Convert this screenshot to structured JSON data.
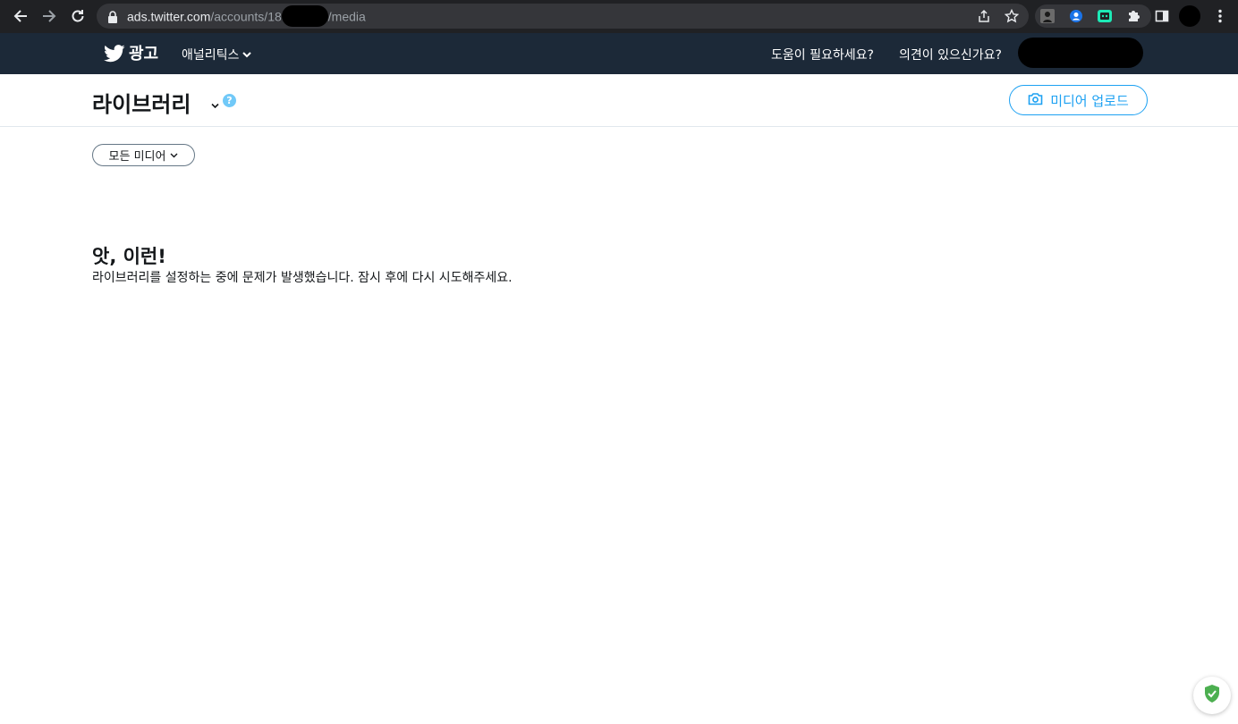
{
  "browser": {
    "url_host": "ads.twitter.com",
    "url_path_prefix": "/accounts/18",
    "url_path_suffix": "/media",
    "icons": [
      "back-icon",
      "forward-icon",
      "reload-icon",
      "lock-icon",
      "share-icon",
      "bookmark-star-icon",
      "extension-icon",
      "side-panel-icon",
      "profile-avatar",
      "menu-icon"
    ]
  },
  "ads_header": {
    "brand": "광고",
    "analytics_label": "애널리틱스",
    "help_label": "도움이 필요하세요?",
    "feedback_label": "의견이 있으신가요?"
  },
  "page": {
    "title": "라이브러리",
    "help_glyph": "?",
    "upload_label": "미디어 업로드",
    "filter_label": "모든 미디어"
  },
  "error": {
    "title": "앗, 이런!",
    "message": "라이브러리를 설정하는 중에 문제가 발생했습니다. 잠시 후에 다시 시도해주세요."
  },
  "colors": {
    "chrome_bg": "#202124",
    "header_bg": "#1c2938",
    "accent": "#1da1f2",
    "help_dot": "#71c9f8",
    "shield_green": "#4caf50"
  }
}
